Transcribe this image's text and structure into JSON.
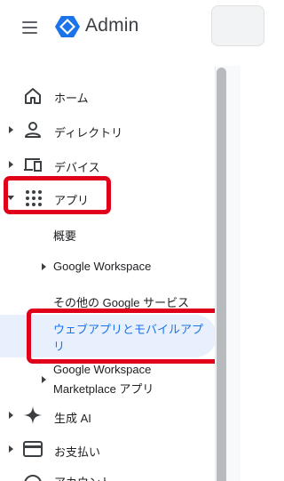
{
  "header": {
    "brand": "Admin",
    "menu_icon": "hamburger-menu-icon",
    "logo_icon": "google-admin-hexagon-logo",
    "logo_color": "#1a73e8"
  },
  "nav": {
    "items": [
      {
        "label": "ホーム",
        "icon": "home-icon"
      },
      {
        "label": "ディレクトリ",
        "icon": "person-icon"
      },
      {
        "label": "デバイス",
        "icon": "devices-icon"
      },
      {
        "label": "アプリ",
        "icon": "apps-grid-icon"
      },
      {
        "label": "概要"
      },
      {
        "label": "Google Workspace"
      },
      {
        "label": "その他の Google サービス"
      },
      {
        "label_line1": "ウェブアプリとモバイルアプ",
        "label_line2": "リ",
        "selected": true
      },
      {
        "label_line1": "Google Workspace",
        "label_line2": "Marketplace アプリ"
      },
      {
        "label": "生成 AI",
        "icon": "sparkle-icon"
      },
      {
        "label": "お支払い",
        "icon": "credit-card-icon"
      },
      {
        "label": "アカウント",
        "icon": "account-circle-icon"
      }
    ]
  },
  "colors": {
    "highlight": "#e0001a",
    "selected_bg": "#e8f0fe",
    "selected_text": "#1a73e8",
    "icon": "#3c4043"
  }
}
